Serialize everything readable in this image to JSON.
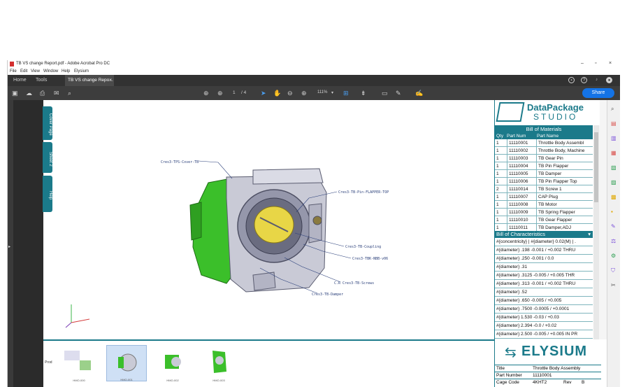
{
  "window": {
    "title": "TB VS change Report.pdf - Adobe Acrobat Pro DC",
    "controls": {
      "minimize": "–",
      "maximize": "▫",
      "close": "×"
    }
  },
  "menu": [
    "File",
    "Edit",
    "View",
    "Window",
    "Help",
    "Elysium"
  ],
  "tabs": {
    "home": "Home",
    "tools": "Tools",
    "document": "TB VS change Repo...",
    "close": "×"
  },
  "toolbar": {
    "page_current": "1",
    "page_total": "/ 4",
    "zoom": "111%",
    "share_label": "Share"
  },
  "side_tabs": [
    "Cover Page",
    "Sheet 2",
    "Help"
  ],
  "callouts": [
    "Cres3-TPS-Cover-TB",
    "Cres3-TB-Pin-FLAPPER-TOP",
    "Cres3-TB-Coupling",
    "Cres3-TBK-NBB-v06",
    "C.R Cres3-TB-Screws",
    "Cres3-TB-Damper"
  ],
  "panel": {
    "brand_line1": "DataPackage",
    "brand_line2": "STUDIO",
    "bom_title": "Bill of Materials",
    "bom_columns": [
      "Qty",
      "Part Num",
      "Part Name"
    ],
    "bom_rows": [
      {
        "qty": "1",
        "num": "11110001",
        "name": "Throttle Body Assembl"
      },
      {
        "qty": "1",
        "num": "11110002",
        "name": "Throttle Body, Machine"
      },
      {
        "qty": "1",
        "num": "11110003",
        "name": "TB Gear Pin"
      },
      {
        "qty": "1",
        "num": "11110004",
        "name": "TB Pin Flapper"
      },
      {
        "qty": "1",
        "num": "11110005",
        "name": "TB Damper"
      },
      {
        "qty": "1",
        "num": "11110006",
        "name": "TB Pin Flapper Top"
      },
      {
        "qty": "2",
        "num": "11110014",
        "name": "TB Screw 1"
      },
      {
        "qty": "1",
        "num": "11110007",
        "name": "CAP Plug"
      },
      {
        "qty": "1",
        "num": "11110008",
        "name": "TB Motor"
      },
      {
        "qty": "1",
        "num": "11110009",
        "name": "TB Spring Flapper"
      },
      {
        "qty": "1",
        "num": "11110010",
        "name": "TB Gear Flapper"
      },
      {
        "qty": "1",
        "num": "11110011",
        "name": "TB Damper,ADJ"
      }
    ],
    "char_title": "Bill of Characteristics",
    "char_rows": [
      "#{concentricity} | #{diameter} 0.02(M) | .",
      "#{diameter} .198 -0.001 / +0.002 THRU",
      "#{diameter} .250 -0.001 / 0.0",
      "#{diameter} .31",
      "#{diameter} .3125 -0.005 / +0.005  THR",
      "#{diameter} .313 -0.001 / +0.002  THRU",
      "#{diameter} .52",
      "#{diameter} .650 -0.005 / +0.005",
      "#{diameter} .7500 -0.0005 / +0.0001",
      "#{diameter} 1.530 -0.03 / +0.03",
      "#{diameter} 2.394 -0.0 / +0.02",
      "#{diameter} 2.500 -0.005 / +0.005 IN PR"
    ]
  },
  "title_block": {
    "logo": "ELYSIUM",
    "title_label": "Title",
    "title_value": "Throttle Body Assembly",
    "part_label": "Part Number",
    "part_value": "11110001",
    "cage_label": "Cage Code",
    "cage_value": "4KHT2",
    "rev_label": "Rev",
    "rev_value": "B"
  },
  "thumbnails": {
    "side_label": "Prod",
    "labels": [
      "HMO-000",
      "HMO-001",
      "HMO-002",
      "HMO-003"
    ]
  },
  "colors": {
    "accent": "#1b7a8a",
    "share": "#1473e6",
    "tabbar": "#323232",
    "toolbar": "#3d3d3d"
  }
}
